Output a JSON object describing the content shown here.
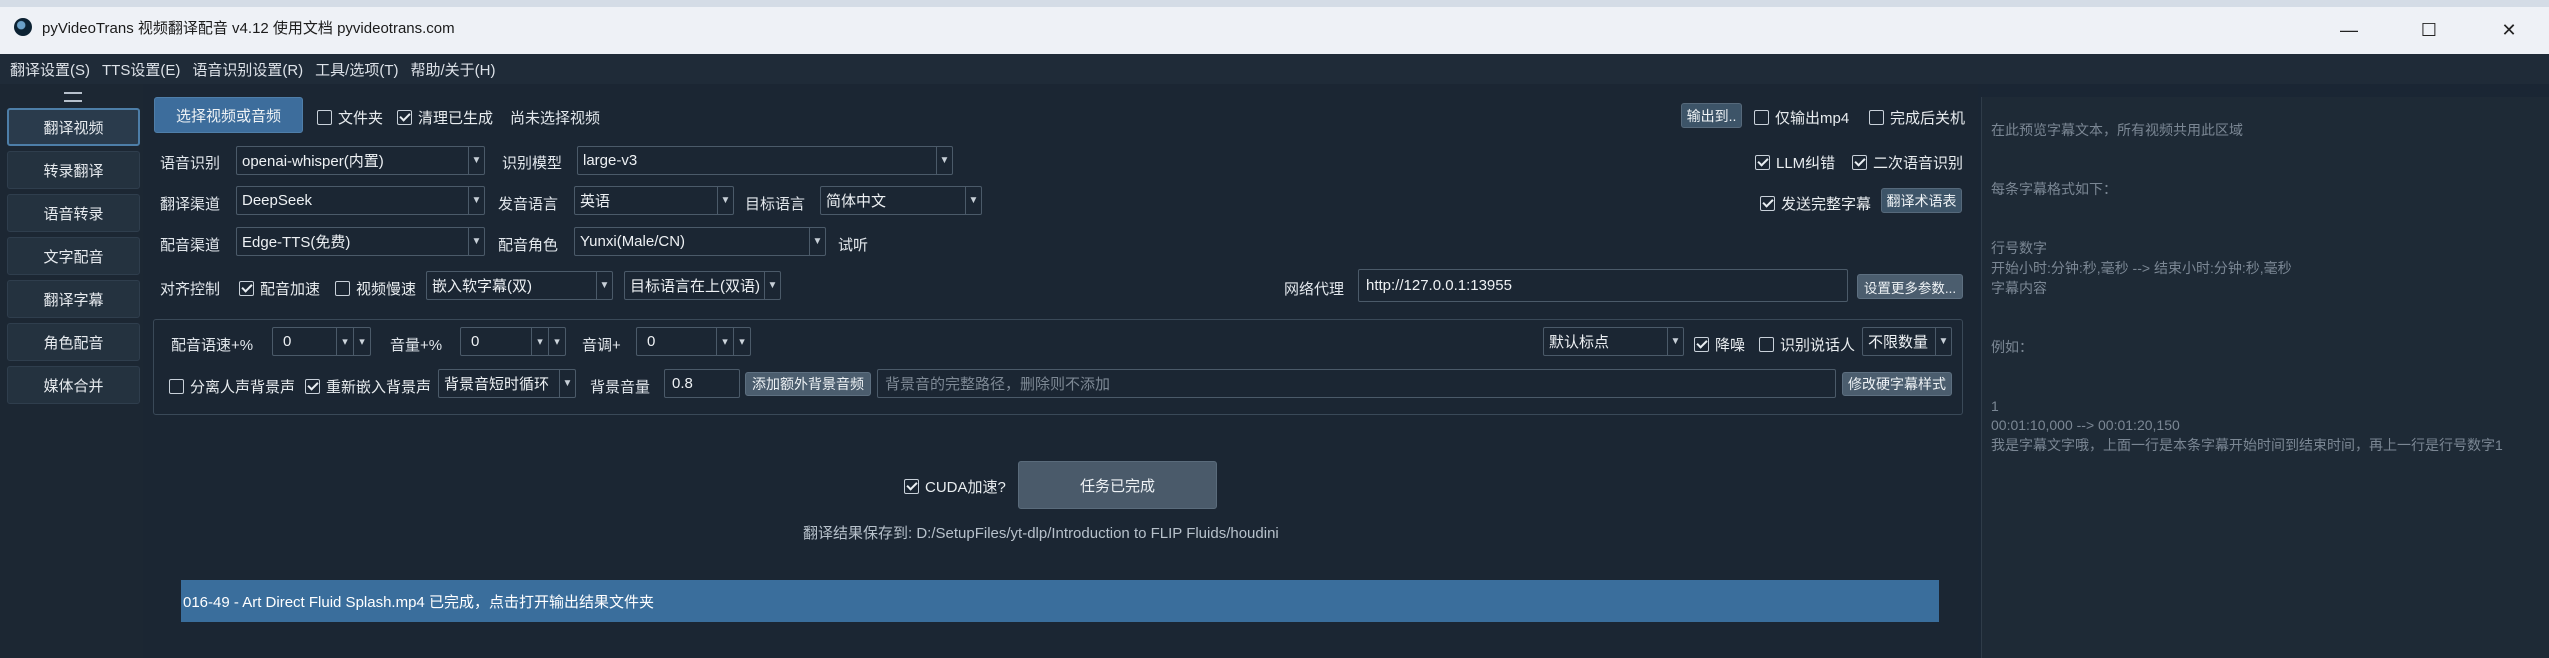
{
  "window": {
    "title": "pyVideoTrans 视频翻译配音 v4.12 使用文档 pyvideotrans.com",
    "minimize_glyph": "—",
    "maximize_glyph": "☐",
    "close_glyph": "✕"
  },
  "menu": [
    "翻译设置(S)",
    "TTS设置(E)",
    "语音识别设置(R)",
    "工具/选项(T)",
    "帮助/关于(H)"
  ],
  "sidebar": {
    "items": [
      "翻译视频",
      "转录翻译",
      "语音转录",
      "文字配音",
      "翻译字幕",
      "角色配音",
      "媒体合并"
    ],
    "active_index": 0
  },
  "top_row": {
    "select_button": "选择视频或音频",
    "folder_checkbox": {
      "label": "文件夹",
      "checked": false
    },
    "clean_checkbox": {
      "label": "清理已生成",
      "checked": true
    },
    "no_video_text": "尚未选择视频",
    "output_button": "输出到..",
    "only_mp4": {
      "label": "仅输出mp4",
      "checked": false
    },
    "shutdown": {
      "label": "完成后关机",
      "checked": false
    }
  },
  "row_asr": {
    "asr_label": "语音识别",
    "asr_value": "openai-whisper(内置)",
    "model_label": "识别模型",
    "model_value": "large-v3",
    "llm_fix": {
      "label": "LLM纠错",
      "checked": true
    },
    "second_asr": {
      "label": "二次语音识别",
      "checked": true
    }
  },
  "row_translate": {
    "channel_label": "翻译渠道",
    "channel_value": "DeepSeek",
    "source_lang_label": "发音语言",
    "source_lang_value": "英语",
    "target_lang_label": "目标语言",
    "target_lang_value": "简体中文",
    "send_full": {
      "label": "发送完整字幕",
      "checked": true
    },
    "glossary_button": "翻译术语表"
  },
  "row_dub": {
    "dub_channel_label": "配音渠道",
    "dub_channel_value": "Edge-TTS(免费)",
    "role_label": "配音角色",
    "role_value": "Yunxi(Male/CN)",
    "listen_label": "试听"
  },
  "row_align": {
    "align_label": "对齐控制",
    "dub_speed": {
      "label": "配音加速",
      "checked": true
    },
    "video_slow": {
      "label": "视频慢速",
      "checked": false
    },
    "subtitle_embed_value": "嵌入软字幕(双)",
    "subtitle_order_value": "目标语言在上(双语)",
    "proxy_label": "网络代理",
    "proxy_value": "http://127.0.0.1:13955",
    "more_params_button": "设置更多参数..."
  },
  "panel": {
    "rate_label": "配音语速+%",
    "rate_value": "0",
    "volume_label": "音量+%",
    "volume_value": "0",
    "pitch_label": "音调+",
    "pitch_value": "0",
    "punct_value": "默认标点",
    "denoise": {
      "label": "降噪",
      "checked": true
    },
    "speaker": {
      "label": "识别说话人",
      "checked": false
    },
    "speaker_count_value": "不限数量",
    "separate_bg": {
      "label": "分离人声背景声",
      "checked": false
    },
    "reembed_bg": {
      "label": "重新嵌入背景声",
      "checked": true
    },
    "bg_loop_value": "背景音短时循环",
    "bg_volume_label": "背景音量",
    "bg_volume_value": "0.8",
    "add_bg_button": "添加额外背景音频",
    "bg_path_placeholder": "背景音的完整路径，删除则不添加",
    "hard_sub_style_button": "修改硬字幕样式"
  },
  "run": {
    "cuda": {
      "label": "CUDA加速?",
      "checked": true
    },
    "task_button": "任务已完成",
    "save_note": "翻译结果保存到: D:/SetupFiles/yt-dlp/Introduction to FLIP Fluids/houdini"
  },
  "status_bar": {
    "text": "016-49 - Art Direct Fluid Splash.mp4  已完成，点击打开输出结果文件夹"
  },
  "preview": {
    "lines": [
      "在此预览字幕文本，所有视频共用此区域",
      "",
      "",
      "每条字幕格式如下：",
      "",
      "",
      "行号数字",
      "开始小时:分钟:秒,毫秒 --> 结束小时:分钟:秒,毫秒",
      "字幕内容",
      "",
      "",
      "例如：",
      "",
      "",
      "1",
      "00:01:10,000 --> 00:01:20,150",
      "我是字幕文字哦，上面一行是本条字幕开始时间到结束时间，再上一行是行号数字1"
    ]
  },
  "colors": {
    "background": "#1b2633",
    "accent": "#3d6d9c",
    "status_bar": "#3a6e9c",
    "titlebar": "#eef1f6"
  }
}
